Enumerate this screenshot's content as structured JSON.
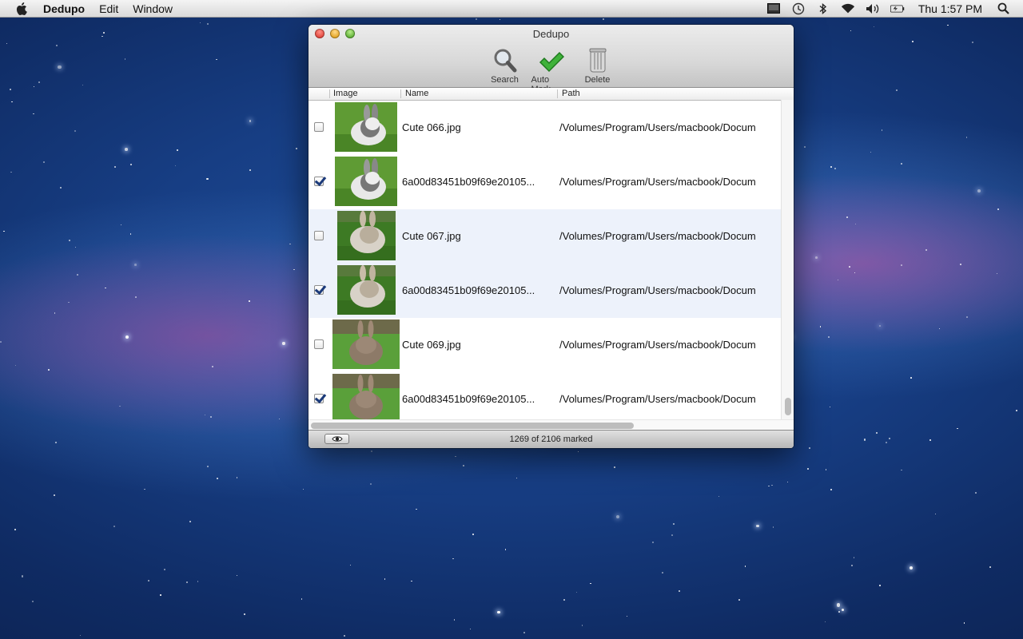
{
  "menubar": {
    "app_name": "Dedupo",
    "menus": [
      "Edit",
      "Window"
    ],
    "clock": "Thu 1:57 PM",
    "status_icons": [
      "display-icon",
      "time-machine-icon",
      "bluetooth-icon",
      "wifi-icon",
      "volume-icon",
      "battery-icon",
      "spotlight-icon"
    ]
  },
  "window": {
    "title": "Dedupo",
    "toolbar": {
      "search_label": "Search",
      "automark_label": "Auto Mark",
      "delete_label": "Delete"
    },
    "columns": {
      "image": "Image",
      "name": "Name",
      "path": "Path"
    },
    "rows": [
      {
        "checked": false,
        "name": "Cute 066.jpg",
        "path": "/Volumes/Program/Users/macbook/Docum",
        "thumb": "white-gray-bunny"
      },
      {
        "checked": true,
        "name": "6a00d83451b09f69e20105...",
        "path": "/Volumes/Program/Users/macbook/Docum",
        "thumb": "white-gray-bunny"
      },
      {
        "checked": false,
        "name": "Cute 067.jpg",
        "path": "/Volumes/Program/Users/macbook/Docum",
        "thumb": "fluffy-bunny"
      },
      {
        "checked": true,
        "name": "6a00d83451b09f69e20105...",
        "path": "/Volumes/Program/Users/macbook/Docum",
        "thumb": "fluffy-bunny"
      },
      {
        "checked": false,
        "name": "Cute 069.jpg",
        "path": "/Volumes/Program/Users/macbook/Docum",
        "thumb": "brown-bunny"
      },
      {
        "checked": true,
        "name": "6a00d83451b09f69e20105...",
        "path": "/Volumes/Program/Users/macbook/Docum",
        "thumb": "brown-bunny"
      }
    ],
    "status": "1269 of 2106 marked"
  }
}
